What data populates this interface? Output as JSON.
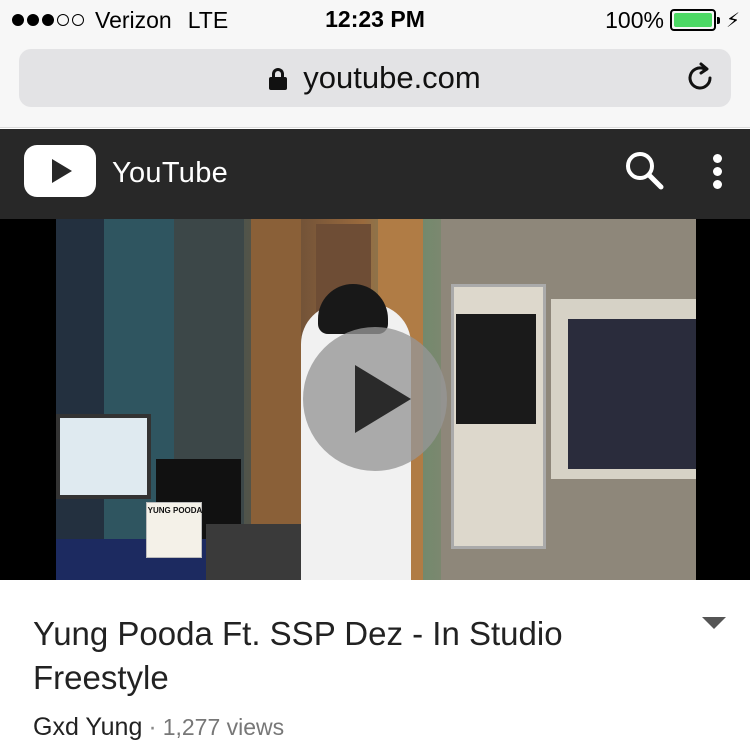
{
  "status_bar": {
    "carrier": "Verizon",
    "network": "LTE",
    "time": "12:23 PM",
    "battery": "100%",
    "battery_level": 1.0,
    "signal_bars_filled": 3,
    "signal_bars_total": 5,
    "battery_color": "#4cd964"
  },
  "browser": {
    "url": "youtube.com",
    "icons": [
      "lock-icon",
      "reload-icon"
    ]
  },
  "youtube": {
    "title": "YouTube",
    "header_color": "#282828",
    "icons": [
      "youtube-logo-icon",
      "search-icon",
      "more-vertical-icon"
    ]
  },
  "video": {
    "watermark_text": "YUNG POODA",
    "title": "Yung Pooda Ft. SSP Dez - In Studio Freestyle",
    "channel": "Gxd Yung",
    "separator": "·",
    "views": "1,277 views"
  }
}
